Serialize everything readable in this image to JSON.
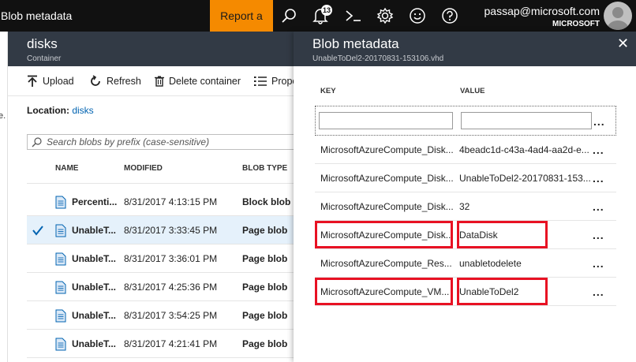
{
  "topbar": {
    "title": "Blob metadata",
    "report_bug": "Report a bug",
    "notification_count": "13",
    "user_email": "passap@microsoft.com",
    "user_org": "MICROSOFT",
    "icons": [
      "search-icon",
      "bell-icon",
      "cloud-shell-icon",
      "gear-icon",
      "smiley-icon",
      "help-icon"
    ]
  },
  "left_fragment": "e.",
  "container": {
    "title": "disks",
    "subtitle": "Container",
    "toolbar": {
      "upload": "Upload",
      "refresh": "Refresh",
      "delete_container": "Delete container",
      "properties": "Prope"
    },
    "location_label": "Location:",
    "location_value": "disks",
    "search_placeholder": "Search blobs by prefix (case-sensitive)",
    "columns": {
      "name": "NAME",
      "modified": "MODIFIED",
      "type": "BLOB TYPE"
    },
    "rows": [
      {
        "name": "Percenti...",
        "modified": "8/31/2017 4:13:15 PM",
        "type": "Block blob",
        "selected": false
      },
      {
        "name": "UnableT...",
        "modified": "8/31/2017 3:33:45 PM",
        "type": "Page blob",
        "selected": true
      },
      {
        "name": "UnableT...",
        "modified": "8/31/2017 3:36:01 PM",
        "type": "Page blob",
        "selected": false
      },
      {
        "name": "UnableT...",
        "modified": "8/31/2017 4:25:36 PM",
        "type": "Page blob",
        "selected": false
      },
      {
        "name": "UnableT...",
        "modified": "8/31/2017 3:54:25 PM",
        "type": "Page blob",
        "selected": false
      },
      {
        "name": "UnableT...",
        "modified": "8/31/2017 4:21:41 PM",
        "type": "Page blob",
        "selected": false
      }
    ]
  },
  "metadata": {
    "title": "Blob metadata",
    "subtitle": "UnableToDel2-20170831-153106.vhd",
    "close": "✕",
    "col_key": "KEY",
    "col_value": "VALUE",
    "new_key_value": "",
    "new_value_value": "",
    "rows": [
      {
        "key": "MicrosoftAzureCompute_Disk...",
        "value": "4beadc1d-c43a-4ad4-aa2d-e..."
      },
      {
        "key": "MicrosoftAzureCompute_Disk...",
        "value": "UnableToDel2-20170831-153..."
      },
      {
        "key": "MicrosoftAzureCompute_Disk...",
        "value": "32"
      },
      {
        "key": "MicrosoftAzureCompute_Disk...",
        "value": "DataDisk"
      },
      {
        "key": "MicrosoftAzureCompute_Res...",
        "value": "unabletodelete"
      },
      {
        "key": "MicrosoftAzureCompute_VM...",
        "value": "UnableToDel2"
      }
    ],
    "ellipsis": "...",
    "highlight_color": "#e81123"
  }
}
